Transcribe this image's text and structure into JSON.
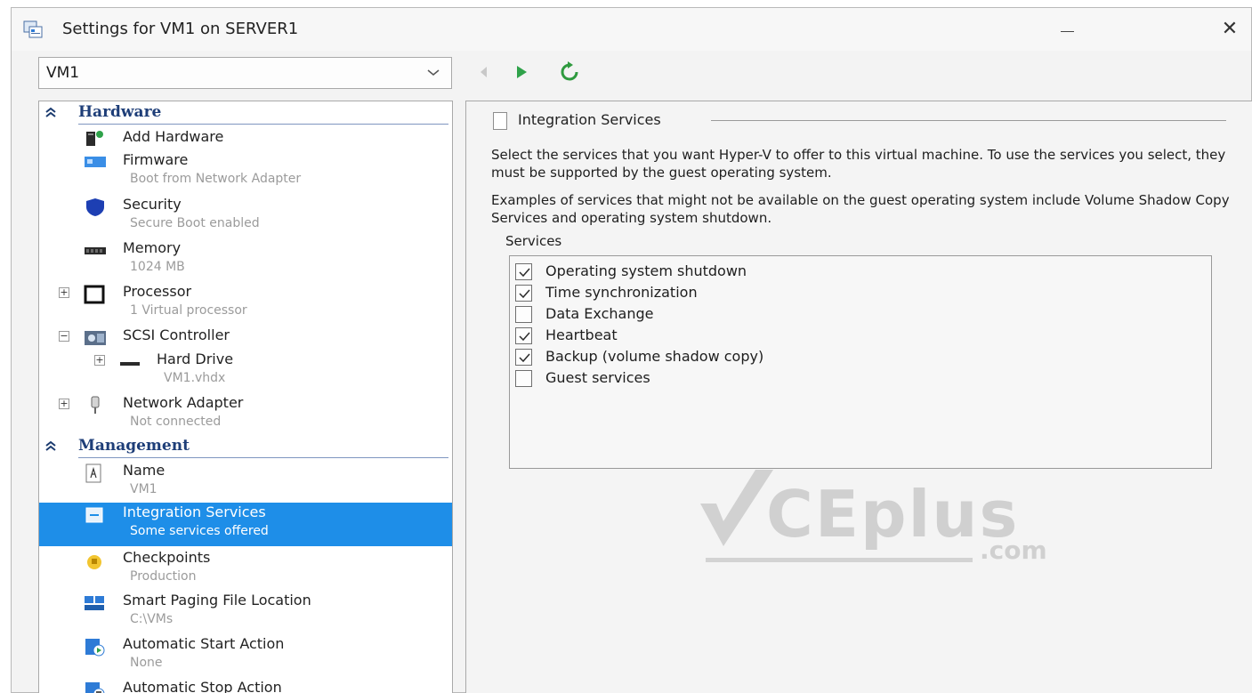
{
  "window": {
    "title": "Settings for VM1 on SERVER1",
    "close_glyph": "✕"
  },
  "vm_selector": {
    "value": "VM1"
  },
  "toolbar": {
    "icons": [
      "back-arrow-icon",
      "play-icon",
      "refresh-icon"
    ]
  },
  "sidebar": {
    "hardware": {
      "title": "Hardware",
      "items": [
        {
          "label": "Add Hardware",
          "sub": ""
        },
        {
          "label": "Firmware",
          "sub": "Boot from Network Adapter"
        },
        {
          "label": "Security",
          "sub": "Secure Boot enabled"
        },
        {
          "label": "Memory",
          "sub": "1024 MB"
        },
        {
          "label": "Processor",
          "sub": "1 Virtual processor"
        },
        {
          "label": "SCSI Controller",
          "sub": ""
        },
        {
          "label": "Hard Drive",
          "sub": "VM1.vhdx"
        },
        {
          "label": "Network Adapter",
          "sub": "Not connected"
        }
      ]
    },
    "management": {
      "title": "Management",
      "items": [
        {
          "label": "Name",
          "sub": "VM1"
        },
        {
          "label": "Integration Services",
          "sub": "Some services offered"
        },
        {
          "label": "Checkpoints",
          "sub": "Production"
        },
        {
          "label": "Smart Paging File Location",
          "sub": "C:\\VMs"
        },
        {
          "label": "Automatic Start Action",
          "sub": "None"
        },
        {
          "label": "Automatic Stop Action",
          "sub": ""
        }
      ]
    }
  },
  "content": {
    "title": "Integration Services",
    "paragraph1": "Select the services that you want Hyper-V to offer to this virtual machine. To use the services you select, they must be supported by the guest operating system.",
    "paragraph2": "Examples of services that might not be available on the guest operating system include Volume Shadow Copy Services and operating system shutdown.",
    "services_label": "Services",
    "services": [
      {
        "label": "Operating system shutdown",
        "checked": true
      },
      {
        "label": "Time synchronization",
        "checked": true
      },
      {
        "label": "Data Exchange",
        "checked": false
      },
      {
        "label": "Heartbeat",
        "checked": true
      },
      {
        "label": "Backup (volume shadow copy)",
        "checked": true
      },
      {
        "label": "Guest services",
        "checked": false
      }
    ]
  },
  "watermark": {
    "text": "CEplus",
    "suffix": ".com"
  }
}
